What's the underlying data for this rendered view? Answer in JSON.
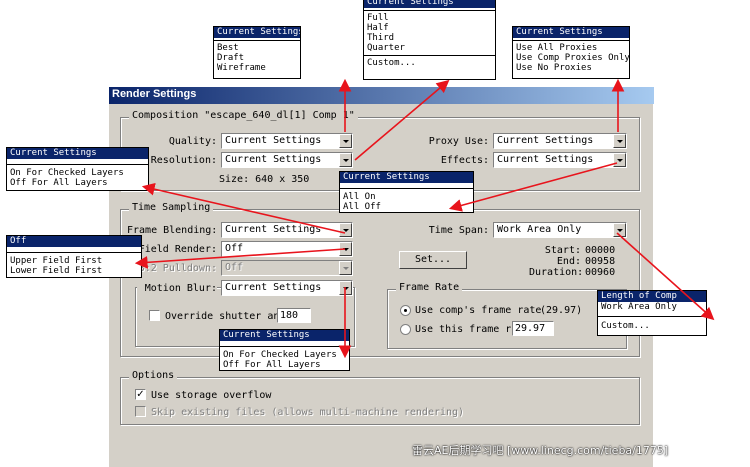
{
  "dialog": {
    "title": "Render Settings",
    "composition_title": "Composition \"escape_640_dl[1] Comp 1\"",
    "quality_label": "Quality:",
    "quality_value": "Current Settings",
    "resolution_label": "Resolution:",
    "resolution_value": "Current Settings",
    "size_label": "Size: 640 x 350",
    "proxy_use_label": "Proxy Use:",
    "proxy_use_value": "Current Settings",
    "effects_label": "Effects:",
    "effects_value": "Current Settings"
  },
  "time_sampling": {
    "title": "Time Sampling",
    "frame_blending_label": "Frame Blending:",
    "frame_blending_value": "Current Settings",
    "field_render_label": "Field Render:",
    "field_render_value": "Off",
    "pulldown_label": "3:2 Pulldown:",
    "pulldown_value": "Off",
    "motion_blur_label": "Motion Blur:",
    "motion_blur_value": "Current Settings",
    "override_shutter_label": "Override shutter angl",
    "override_shutter_value": "180",
    "time_span_label": "Time Span:",
    "time_span_value": "Work Area Only",
    "set_button": "Set...",
    "start_label": "Start:",
    "start_value": "00000",
    "end_label": "End:",
    "end_value": "00958",
    "duration_label": "Duration:",
    "duration_value": "00960"
  },
  "frame_rate": {
    "title": "Frame Rate",
    "use_comp_label": "Use comp's frame rate",
    "use_comp_value": "(29.97)",
    "use_this_label": "Use this frame rat",
    "use_this_value": "29.97"
  },
  "options": {
    "title": "Options",
    "storage_overflow_label": "Use storage overflow",
    "skip_existing_label": "Skip existing files (allows multi-machine rendering)"
  },
  "popups": {
    "quality": {
      "header": "Current Settings",
      "items": [
        "Best",
        "Draft",
        "Wireframe"
      ]
    },
    "resolution": {
      "header": "Current Settings",
      "items": [
        "Full",
        "Half",
        "Third",
        "Quarter"
      ],
      "extra": "Custom..."
    },
    "proxy": {
      "header": "Current Settings",
      "items": [
        "Use All Proxies",
        "Use Comp Proxies Only",
        "Use No Proxies"
      ]
    },
    "frame_blending": {
      "header": "Current Settings",
      "items": [
        "On For Checked Layers",
        "Off For All Layers"
      ]
    },
    "effects": {
      "header": "Current Settings",
      "items": [
        "All On",
        "All Off"
      ]
    },
    "field_render": {
      "header": "Off",
      "items": [
        "Upper Field First",
        "Lower Field First"
      ]
    },
    "time_span": {
      "header": "Length of Comp",
      "items": [
        "Work Area Only"
      ],
      "extra": "Custom..."
    },
    "motion_blur": {
      "header": "Current Settings",
      "items": [
        "On For Checked Layers",
        "Off For All Layers"
      ]
    }
  },
  "watermark": "雷云AE后期学习吧 [www.linecg.com/tieba/1775]",
  "colors": {
    "dialog_bg": "#d4d0c8",
    "title_start": "#0a246a",
    "title_end": "#a6caf0",
    "highlight": "#0a246a",
    "arrow": "#e8141c"
  }
}
